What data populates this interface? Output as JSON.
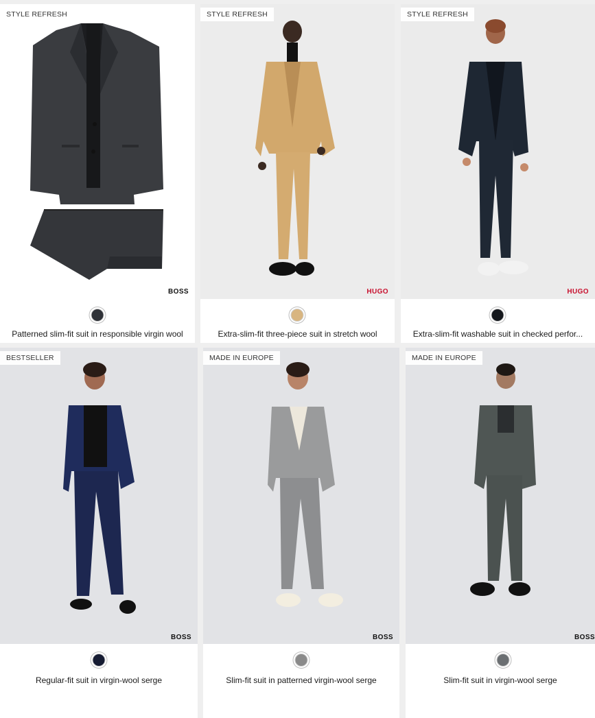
{
  "products": [
    {
      "badge": "STYLE REFRESH",
      "brand": "BOSS",
      "brand_color": "#111111",
      "swatch_color": "#2f3238",
      "title": "Patterned slim-fit suit in responsible virgin wool",
      "image_background": "#ffffff"
    },
    {
      "badge": "STYLE REFRESH",
      "brand": "HUGO",
      "brand_color": "#c8102e",
      "swatch_color": "#d8b580",
      "title": "Extra-slim-fit three-piece suit in stretch wool",
      "image_background": "#ececec"
    },
    {
      "badge": "STYLE REFRESH",
      "brand": "HUGO",
      "brand_color": "#c8102e",
      "swatch_color": "#15181d",
      "title": "Extra-slim-fit washable suit in checked perfor...",
      "image_background": "#ebebeb"
    },
    {
      "badge": "BESTSELLER",
      "brand": "BOSS",
      "brand_color": "#111111",
      "swatch_color": "#161c33",
      "title": "Regular-fit suit in virgin-wool serge",
      "image_background": "#e2e3e6"
    },
    {
      "badge": "MADE IN EUROPE",
      "brand": "BOSS",
      "brand_color": "#111111",
      "swatch_color": "#8a8a8a",
      "title": "Slim-fit suit in patterned virgin-wool serge",
      "image_background": "#e2e3e6"
    },
    {
      "badge": "MADE IN EUROPE",
      "brand": "BOSS",
      "brand_color": "#111111",
      "swatch_color": "#6b6f72",
      "title": "Slim-fit suit in virgin-wool serge",
      "image_background": "#e2e3e6"
    }
  ]
}
